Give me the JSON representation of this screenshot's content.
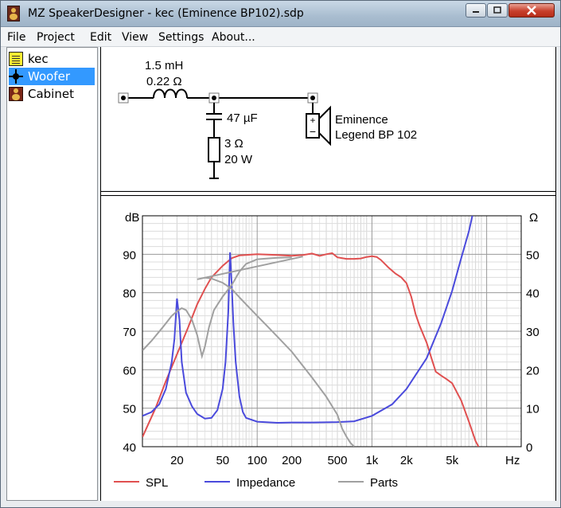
{
  "window": {
    "title": "MZ SpeakerDesigner - kec (Eminence BP102).sdp"
  },
  "menu": [
    "File",
    "Project",
    "Edit",
    "View",
    "Settings",
    "About..."
  ],
  "tree": {
    "items": [
      {
        "label": "kec",
        "icon": "project-icon",
        "selected": false
      },
      {
        "label": "Woofer",
        "icon": "crossover-icon",
        "selected": true
      },
      {
        "label": "Cabinet",
        "icon": "cabinet-icon",
        "selected": false
      }
    ]
  },
  "circuit": {
    "inductor_value": "1.5 mH",
    "inductor_resistance": "0.22 Ω",
    "capacitor_value": "47 µF",
    "resistor_value": "3 Ω",
    "resistor_power": "20 W",
    "driver_brand": "Eminence",
    "driver_model": "Legend BP 102"
  },
  "chart_data": {
    "type": "line",
    "x_scale": "log",
    "xlim": [
      10,
      20000
    ],
    "x_ticks": [
      "20",
      "50",
      "100",
      "200",
      "500",
      "1k",
      "2k",
      "5k"
    ],
    "x_unit": "Hz",
    "y_left_label": "dB",
    "y_left_ticks": [
      "90",
      "80",
      "70",
      "60",
      "50",
      "40"
    ],
    "ylim_left": [
      40,
      100
    ],
    "y_right_label": "Ω",
    "y_right_ticks": [
      "50",
      "40",
      "30",
      "20",
      "10",
      "0"
    ],
    "ylim_right": [
      0,
      60
    ],
    "grid": true,
    "legend_position": "bottom",
    "series": [
      {
        "name": "SPL",
        "axis": "left",
        "color": "#e05050",
        "points": [
          [
            10,
            42.5
          ],
          [
            13,
            50
          ],
          [
            16,
            57
          ],
          [
            20,
            64
          ],
          [
            25,
            71
          ],
          [
            30,
            77
          ],
          [
            35,
            81
          ],
          [
            40,
            84
          ],
          [
            50,
            87
          ],
          [
            60,
            89
          ],
          [
            70,
            89.7
          ],
          [
            100,
            90
          ],
          [
            150,
            89.8
          ],
          [
            200,
            89.6
          ],
          [
            250,
            89.8
          ],
          [
            300,
            90.2
          ],
          [
            350,
            89.6
          ],
          [
            400,
            90
          ],
          [
            450,
            90.3
          ],
          [
            500,
            89.2
          ],
          [
            600,
            88.8
          ],
          [
            700,
            88.8
          ],
          [
            800,
            88.9
          ],
          [
            900,
            89.3
          ],
          [
            1000,
            89.5
          ],
          [
            1100,
            89.3
          ],
          [
            1200,
            88.5
          ],
          [
            1400,
            86.5
          ],
          [
            1600,
            85
          ],
          [
            1800,
            84
          ],
          [
            2000,
            82.5
          ],
          [
            2200,
            79
          ],
          [
            2400,
            74.5
          ],
          [
            2600,
            71.5
          ],
          [
            3000,
            67
          ],
          [
            3300,
            63
          ],
          [
            3600,
            59.5
          ],
          [
            4000,
            58.5
          ],
          [
            4500,
            57.5
          ],
          [
            5000,
            56.5
          ],
          [
            6000,
            52
          ],
          [
            7000,
            46.5
          ],
          [
            8000,
            41.5
          ],
          [
            8500,
            40
          ]
        ]
      },
      {
        "name": "Impedance",
        "axis": "right",
        "color": "#4a4adc",
        "points": [
          [
            10,
            8
          ],
          [
            12,
            9
          ],
          [
            14,
            11
          ],
          [
            16,
            15
          ],
          [
            18,
            22
          ],
          [
            19,
            28
          ],
          [
            20,
            38.5
          ],
          [
            21,
            33
          ],
          [
            22,
            22
          ],
          [
            24,
            14
          ],
          [
            27,
            10.5
          ],
          [
            30,
            8.5
          ],
          [
            35,
            7.3
          ],
          [
            40,
            7.5
          ],
          [
            45,
            9.5
          ],
          [
            50,
            15
          ],
          [
            53,
            22
          ],
          [
            56,
            35
          ],
          [
            58,
            50.5
          ],
          [
            60,
            42
          ],
          [
            62,
            32
          ],
          [
            65,
            22
          ],
          [
            70,
            13
          ],
          [
            75,
            9
          ],
          [
            80,
            7.5
          ],
          [
            100,
            6.5
          ],
          [
            150,
            6.2
          ],
          [
            200,
            6.3
          ],
          [
            300,
            6.3
          ],
          [
            500,
            6.4
          ],
          [
            700,
            6.6
          ],
          [
            1000,
            8
          ],
          [
            1500,
            11
          ],
          [
            2000,
            15
          ],
          [
            3000,
            23
          ],
          [
            4000,
            32
          ],
          [
            5000,
            40.5
          ],
          [
            6000,
            49
          ],
          [
            7000,
            56
          ],
          [
            7500,
            60
          ]
        ]
      },
      {
        "name": "Parts",
        "axis": "left",
        "color": "#a0a0a0",
        "points": [
          [
            10,
            65
          ],
          [
            12,
            67.5
          ],
          [
            15,
            71
          ],
          [
            18,
            74
          ],
          [
            20,
            75.2
          ],
          [
            22,
            76
          ],
          [
            24,
            75.5
          ],
          [
            27,
            73
          ],
          [
            30,
            69
          ],
          [
            33,
            63.5
          ],
          [
            35,
            66
          ],
          [
            38,
            71
          ],
          [
            42,
            75.5
          ],
          [
            50,
            79
          ],
          [
            60,
            82
          ],
          [
            70,
            85.5
          ],
          [
            80,
            87.5
          ],
          [
            100,
            88.7
          ],
          [
            150,
            89.1
          ],
          [
            200,
            89.2
          ],
          [
            250,
            89.4
          ],
          [
            30,
            83.5
          ],
          [
            35,
            83.9
          ],
          [
            40,
            83.7
          ],
          [
            50,
            82.6
          ],
          [
            60,
            81
          ],
          [
            70,
            78.8
          ],
          [
            80,
            77
          ],
          [
            100,
            74
          ],
          [
            120,
            71.6
          ],
          [
            150,
            68.6
          ],
          [
            200,
            64.7
          ],
          [
            250,
            61
          ],
          [
            300,
            58
          ],
          [
            400,
            53
          ],
          [
            500,
            48.3
          ],
          [
            550,
            44.7
          ],
          [
            600,
            42.6
          ],
          [
            650,
            41
          ],
          [
            700,
            40
          ]
        ]
      }
    ]
  },
  "legend": {
    "spl": "SPL",
    "impedance": "Impedance",
    "parts": "Parts"
  }
}
